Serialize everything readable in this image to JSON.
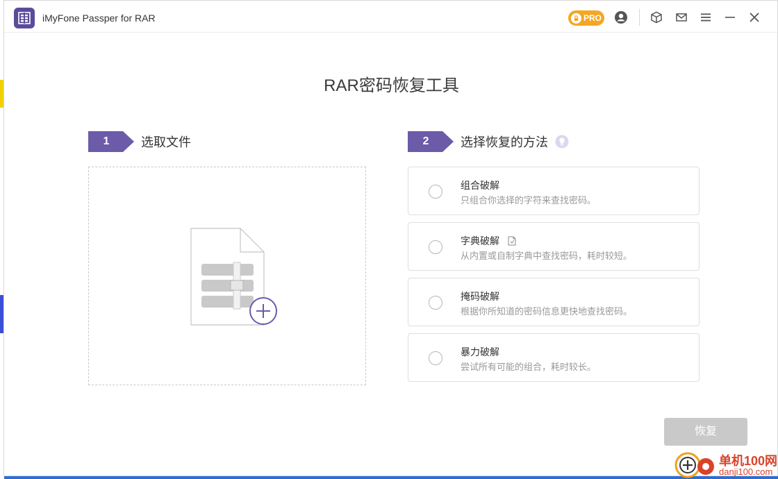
{
  "app": {
    "title": "iMyFone Passper for RAR",
    "pro_label": "PRO"
  },
  "titlebar_icons": [
    "account-icon",
    "package-icon",
    "mail-icon",
    "menu-icon",
    "minimize-icon",
    "close-icon"
  ],
  "main": {
    "title": "RAR密码恢复工具"
  },
  "step1": {
    "number": "1",
    "label": "选取文件"
  },
  "step2": {
    "number": "2",
    "label": "选择恢复的方法"
  },
  "methods": [
    {
      "title": "组合破解",
      "desc": "只组合你选择的字符来查找密码。"
    },
    {
      "title": "字典破解",
      "desc": "从内置或自制字典中查找密码，耗时较短。"
    },
    {
      "title": "掩码破解",
      "desc": "根据你所知道的密码信息更快地查找密码。"
    },
    {
      "title": "暴力破解",
      "desc": "尝试所有可能的组合，耗时较长。"
    }
  ],
  "recover_button": "恢复",
  "watermark": {
    "line1": "单机100网",
    "line2": "danji100.com"
  },
  "colors": {
    "accent": "#6b5ba8",
    "pro": "#f5a623",
    "disabled": "#c9c9c9",
    "watermark": "#d9432a"
  }
}
